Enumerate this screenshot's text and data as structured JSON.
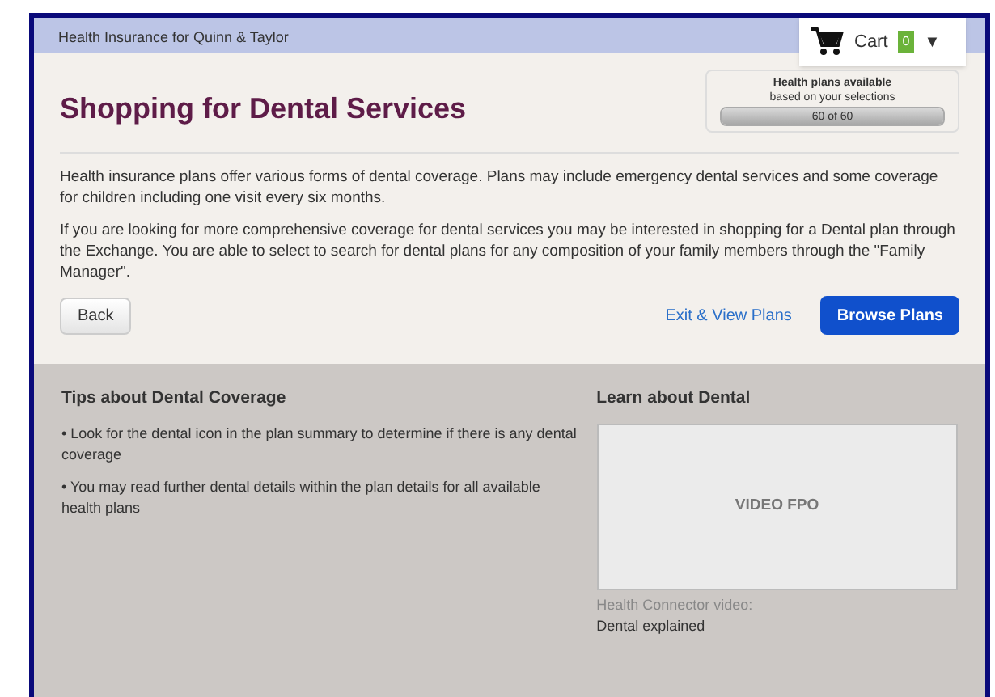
{
  "header": {
    "title": "Health Insurance for Quinn & Taylor",
    "cart": {
      "label": "Cart",
      "count": "0",
      "caret": "▼"
    }
  },
  "page_title": "Shopping for Dental Services",
  "availability": {
    "heading": "Health plans available",
    "subheading": "based on your selections",
    "reading": "60 of 60",
    "level": 1
  },
  "paragraphs": [
    "Health insurance plans offer various forms of dental coverage. Plans may include emergency dental services and some coverage for children including one visit every six months.",
    "If you are looking for more comprehensive coverage for dental services you may be interested in shopping for a Dental plan through the Exchange. You are able to select to search for dental plans for any composition of your family members through the \"Family Manager\"."
  ],
  "actions": {
    "back": "Back",
    "exit_link": "Exit & View Plans",
    "browse": "Browse Plans"
  },
  "tips": {
    "heading": "Tips about Dental Coverage",
    "items": [
      "• Look for the dental icon in the plan summary to determine if there is any dental coverage",
      "• You may read further dental details within the plan details for all available health plans"
    ]
  },
  "learn": {
    "heading": "Learn about Dental",
    "video_label": "VIDEO FPO",
    "caption": "Health Connector video:",
    "video_title": "Dental explained"
  }
}
